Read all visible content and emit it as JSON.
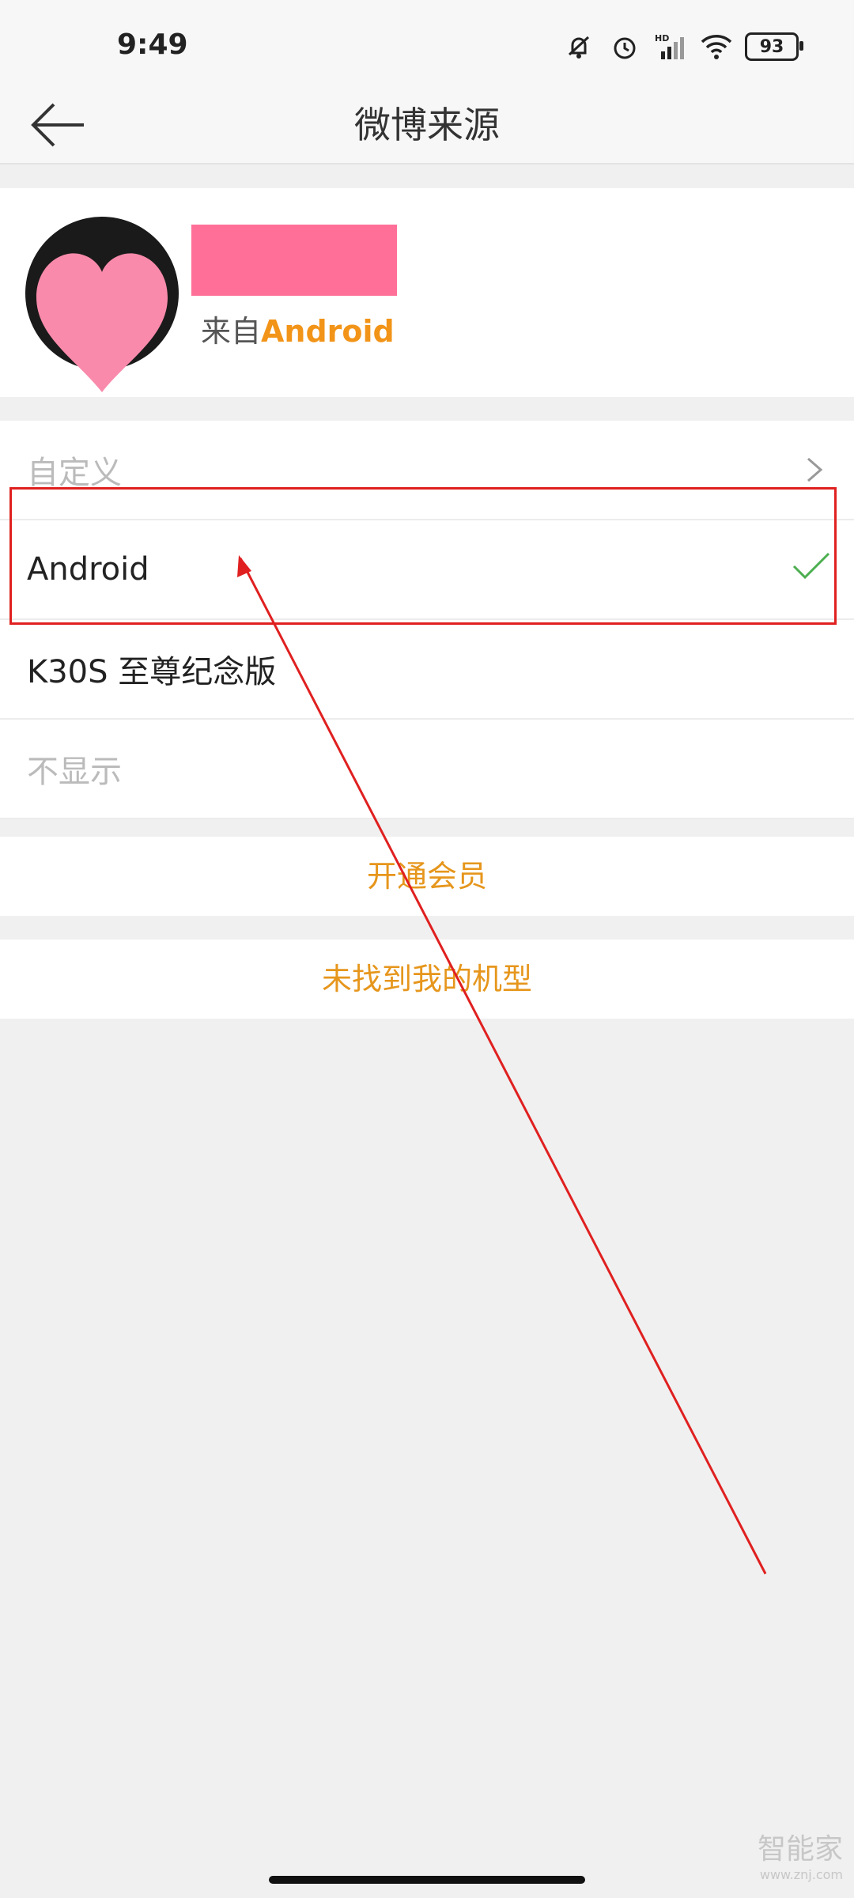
{
  "status_bar": {
    "time": "9:49",
    "battery": "93",
    "icons": [
      "notifications-off-icon",
      "alarm-icon",
      "hd-signal-icon",
      "wifi-icon",
      "battery-icon"
    ]
  },
  "header": {
    "title": "微博来源"
  },
  "profile": {
    "source_prefix": "来自",
    "source_device": "Android"
  },
  "options": [
    {
      "label": "自定义",
      "style": "dim",
      "trailing": "chevron-right-icon"
    },
    {
      "label": "Android",
      "style": "dark",
      "trailing": "check-icon",
      "selected": true
    },
    {
      "label": "K30S 至尊纪念版",
      "style": "dark"
    },
    {
      "label": "不显示",
      "style": "dim"
    }
  ],
  "actions": {
    "open_vip": "开通会员",
    "not_found": "未找到我的机型"
  },
  "watermark": {
    "text": "智能家",
    "url": "www.znj.com"
  },
  "colors": {
    "accent": "#e6961c",
    "check": "#4caf50",
    "annotation": "#e02020",
    "redacted": "#ff6f97"
  }
}
